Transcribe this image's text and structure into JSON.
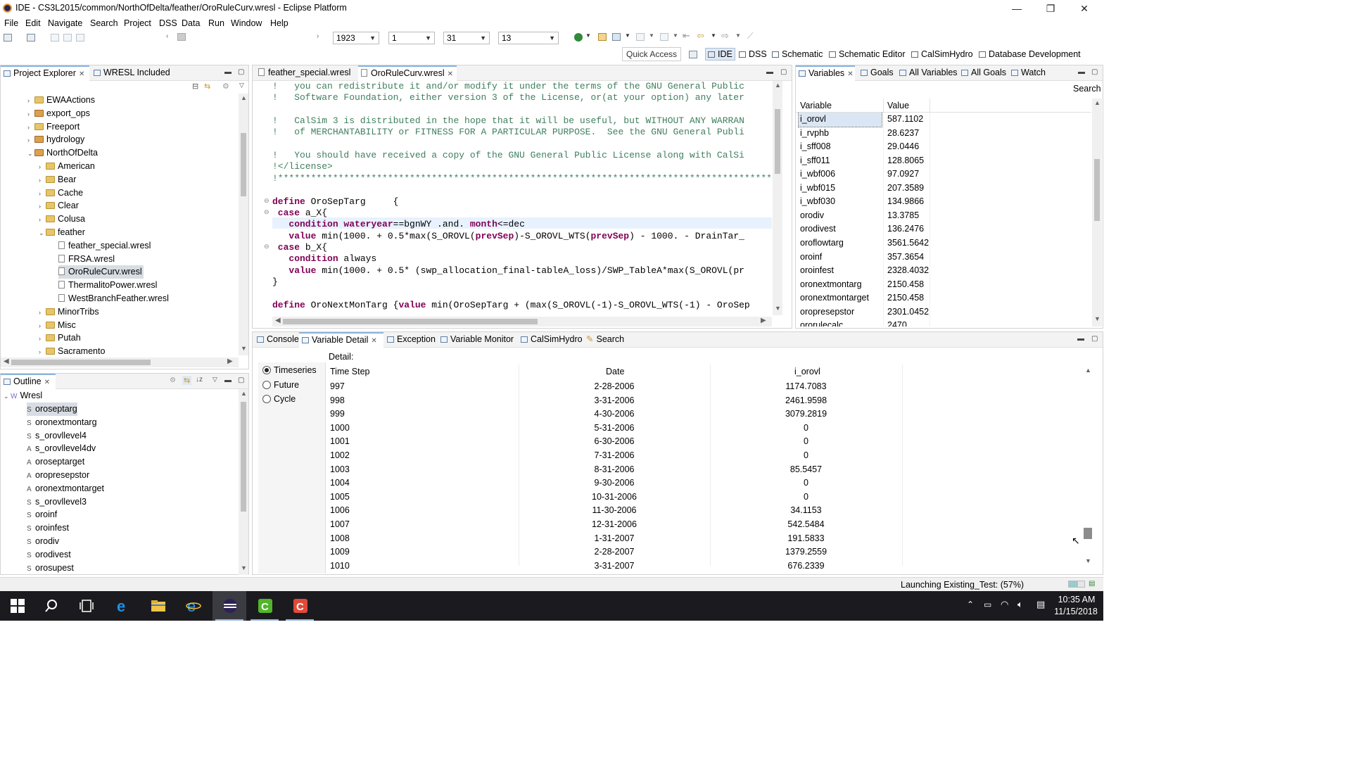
{
  "window": {
    "title": "IDE - CS3L2015/common/NorthOfDelta/feather/OroRuleCurv.wresl - Eclipse Platform",
    "minimize": "—",
    "restore": "❐",
    "close": "✕"
  },
  "menus": [
    "File",
    "Edit",
    "Navigate",
    "Search",
    "Project",
    "DSS",
    "Data",
    "Run",
    "Window",
    "Help"
  ],
  "toolbar": {
    "combos": [
      "1923",
      "1",
      "31",
      "13"
    ],
    "quick_access": "Quick Access",
    "perspectives": [
      "IDE",
      "DSS",
      "Schematic",
      "Schematic Editor",
      "CalSimHydro",
      "Database Development"
    ]
  },
  "project_explorer": {
    "tabs": [
      "Project Explorer",
      "WRESL Included"
    ],
    "tree": [
      {
        "label": "EWAActions",
        "indent": 0,
        "type": "folder",
        "expanded": false
      },
      {
        "label": "export_ops",
        "indent": 0,
        "type": "folder-red",
        "expanded": false
      },
      {
        "label": "Freeport",
        "indent": 0,
        "type": "folder",
        "expanded": false
      },
      {
        "label": "hydrology",
        "indent": 0,
        "type": "folder-red",
        "expanded": false
      },
      {
        "label": "NorthOfDelta",
        "indent": 0,
        "type": "folder-red",
        "expanded": true
      },
      {
        "label": "American",
        "indent": 1,
        "type": "folder",
        "expanded": false
      },
      {
        "label": "Bear",
        "indent": 1,
        "type": "folder",
        "expanded": false
      },
      {
        "label": "Cache",
        "indent": 1,
        "type": "folder",
        "expanded": false
      },
      {
        "label": "Clear",
        "indent": 1,
        "type": "folder",
        "expanded": false
      },
      {
        "label": "Colusa",
        "indent": 1,
        "type": "folder",
        "expanded": false
      },
      {
        "label": "feather",
        "indent": 1,
        "type": "folder",
        "expanded": true
      },
      {
        "label": "feather_special.wresl",
        "indent": 2,
        "type": "file"
      },
      {
        "label": "FRSA.wresl",
        "indent": 2,
        "type": "file"
      },
      {
        "label": "OroRuleCurv.wresl",
        "indent": 2,
        "type": "file",
        "selected": true
      },
      {
        "label": "ThermalitoPower.wresl",
        "indent": 2,
        "type": "file"
      },
      {
        "label": "WestBranchFeather.wresl",
        "indent": 2,
        "type": "file"
      },
      {
        "label": "MinorTribs",
        "indent": 1,
        "type": "folder",
        "expanded": false
      },
      {
        "label": "Misc",
        "indent": 1,
        "type": "folder",
        "expanded": false
      },
      {
        "label": "Putah",
        "indent": 1,
        "type": "folder",
        "expanded": false
      },
      {
        "label": "Sacramento",
        "indent": 1,
        "type": "folder",
        "expanded": false
      }
    ]
  },
  "outline": {
    "tab": "Outline",
    "root": "Wresl",
    "items": [
      {
        "kind": "S",
        "label": "oroseptarg",
        "selected": true
      },
      {
        "kind": "S",
        "label": "oronextmontarg"
      },
      {
        "kind": "S",
        "label": "s_orovllevel4"
      },
      {
        "kind": "A",
        "label": "s_orovllevel4dv"
      },
      {
        "kind": "A",
        "label": "oroseptarget"
      },
      {
        "kind": "A",
        "label": "oropresepstor"
      },
      {
        "kind": "A",
        "label": "oronextmontarget"
      },
      {
        "kind": "S",
        "label": "s_orovllevel3"
      },
      {
        "kind": "S",
        "label": "oroinf"
      },
      {
        "kind": "S",
        "label": "oroinfest"
      },
      {
        "kind": "S",
        "label": "orodiv"
      },
      {
        "kind": "S",
        "label": "orodivest"
      },
      {
        "kind": "S",
        "label": "orosupest"
      }
    ]
  },
  "editor": {
    "tabs": [
      "feather_special.wresl",
      "OroRuleCurv.wresl"
    ],
    "lines": [
      [
        {
          "c": "cmt",
          "t": "!   you can redistribute it and/or modify it under the terms of the GNU General Public"
        }
      ],
      [
        {
          "c": "cmt",
          "t": "!   Software Foundation, either version 3 of the License, or(at your option) any later"
        }
      ],
      [
        {
          "c": "cmt",
          "t": ""
        }
      ],
      [
        {
          "c": "cmt",
          "t": "!   CalSim 3 is distributed in the hope that it will be useful, but WITHOUT ANY WARRAN"
        }
      ],
      [
        {
          "c": "cmt",
          "t": "!   of MERCHANTABILITY or FITNESS FOR A PARTICULAR PURPOSE.  See the GNU General Publi"
        }
      ],
      [
        {
          "c": "cmt",
          "t": ""
        }
      ],
      [
        {
          "c": "cmt",
          "t": "!   You should have received a copy of the GNU General Public License along with CalSi"
        }
      ],
      [
        {
          "c": "cmt",
          "t": "!</license>"
        }
      ],
      [
        {
          "c": "cmt",
          "t": "!**********************************************************************************************"
        }
      ],
      [
        {
          "c": "kw",
          "t": ""
        }
      ],
      [
        {
          "c": "kwb",
          "t": "define"
        },
        {
          "c": "kw",
          "t": " OroSepTarg     {"
        }
      ],
      [
        {
          "c": "kwb",
          "t": " case"
        },
        {
          "c": "kw",
          "t": " a_X{"
        }
      ],
      [
        {
          "c": "kwb",
          "t": "   condition"
        },
        {
          "c": "kwb",
          "t": " wateryear"
        },
        {
          "c": "kw",
          "t": "==bgnWY .and. "
        },
        {
          "c": "kwb",
          "t": "month"
        },
        {
          "c": "kw",
          "t": "<=dec"
        }
      ],
      [
        {
          "c": "kwb",
          "t": "   value"
        },
        {
          "c": "kw",
          "t": " min(1000. + 0.5*max(S_OROVL("
        },
        {
          "c": "kwb",
          "t": "prevSep"
        },
        {
          "c": "kw",
          "t": ")-S_OROVL_WTS("
        },
        {
          "c": "kwb",
          "t": "prevSep"
        },
        {
          "c": "kw",
          "t": ") - 1000. - DrainTar_"
        }
      ],
      [
        {
          "c": "kwb",
          "t": " case"
        },
        {
          "c": "kw",
          "t": " b_X{"
        }
      ],
      [
        {
          "c": "kwb",
          "t": "   condition"
        },
        {
          "c": "kw",
          "t": " always"
        }
      ],
      [
        {
          "c": "kwb",
          "t": "   value"
        },
        {
          "c": "kw",
          "t": " min(1000. + 0.5* (swp_allocation_final-tableA_loss)/SWP_TableA*max(S_OROVL(pr"
        }
      ],
      [
        {
          "c": "kw",
          "t": "}"
        }
      ],
      [
        {
          "c": "kw",
          "t": ""
        }
      ],
      [
        {
          "c": "kwb",
          "t": "define"
        },
        {
          "c": "kw",
          "t": " OroNextMonTarg {"
        },
        {
          "c": "kwb",
          "t": "value"
        },
        {
          "c": "kw",
          "t": " min(OroSepTarg + (max(S_OROVL(-1)-S_OROVL_WTS(-1) - OroSep"
        }
      ]
    ]
  },
  "variables": {
    "tabs": [
      "Variables",
      "Goals",
      "All Variables",
      "All Goals",
      "Watch"
    ],
    "search_label": "Search",
    "headers": [
      "Variable",
      "Value"
    ],
    "rows": [
      [
        "i_orovl",
        "587.1102"
      ],
      [
        "i_rvphb",
        "28.6237"
      ],
      [
        "i_sff008",
        "29.0446"
      ],
      [
        "i_sff011",
        "128.8065"
      ],
      [
        "i_wbf006",
        "97.0927"
      ],
      [
        "i_wbf015",
        "207.3589"
      ],
      [
        "i_wbf030",
        "134.9866"
      ],
      [
        "orodiv",
        "13.3785"
      ],
      [
        "orodivest",
        "136.2476"
      ],
      [
        "oroflowtarg",
        "3561.5642"
      ],
      [
        "oroinf",
        "357.3654"
      ],
      [
        "oroinfest",
        "2328.4032"
      ],
      [
        "oronextmontarg",
        "2150.458"
      ],
      [
        "oronextmontarget",
        "2150.458"
      ],
      [
        "oropresepstor",
        "2301.0452"
      ],
      [
        "ororulecalc",
        "2470"
      ]
    ]
  },
  "bottom": {
    "tabs": [
      "Console",
      "Variable Detail",
      "Exception",
      "Variable Monitor",
      "CalSimHydro",
      "Search"
    ],
    "detail_label": "Detail:",
    "radio_options": [
      "Timeseries",
      "Future",
      "Cycle"
    ],
    "headers": [
      "Time Step",
      "Date",
      "i_orovl"
    ],
    "rows": [
      [
        "997",
        "2-28-2006",
        "1174.7083"
      ],
      [
        "998",
        "3-31-2006",
        "2461.9598"
      ],
      [
        "999",
        "4-30-2006",
        "3079.2819"
      ],
      [
        "1000",
        "5-31-2006",
        "0"
      ],
      [
        "1001",
        "6-30-2006",
        "0"
      ],
      [
        "1002",
        "7-31-2006",
        "0"
      ],
      [
        "1003",
        "8-31-2006",
        "85.5457"
      ],
      [
        "1004",
        "9-30-2006",
        "0"
      ],
      [
        "1005",
        "10-31-2006",
        "0"
      ],
      [
        "1006",
        "11-30-2006",
        "34.1153"
      ],
      [
        "1007",
        "12-31-2006",
        "542.5484"
      ],
      [
        "1008",
        "1-31-2007",
        "191.5833"
      ],
      [
        "1009",
        "2-28-2007",
        "1379.2559"
      ],
      [
        "1010",
        "3-31-2007",
        "676.2339"
      ]
    ]
  },
  "status": {
    "text": "Launching Existing_Test: (57%)",
    "progress": 0.57
  },
  "taskbar": {
    "time": "10:35 AM",
    "date": "11/15/2018"
  }
}
